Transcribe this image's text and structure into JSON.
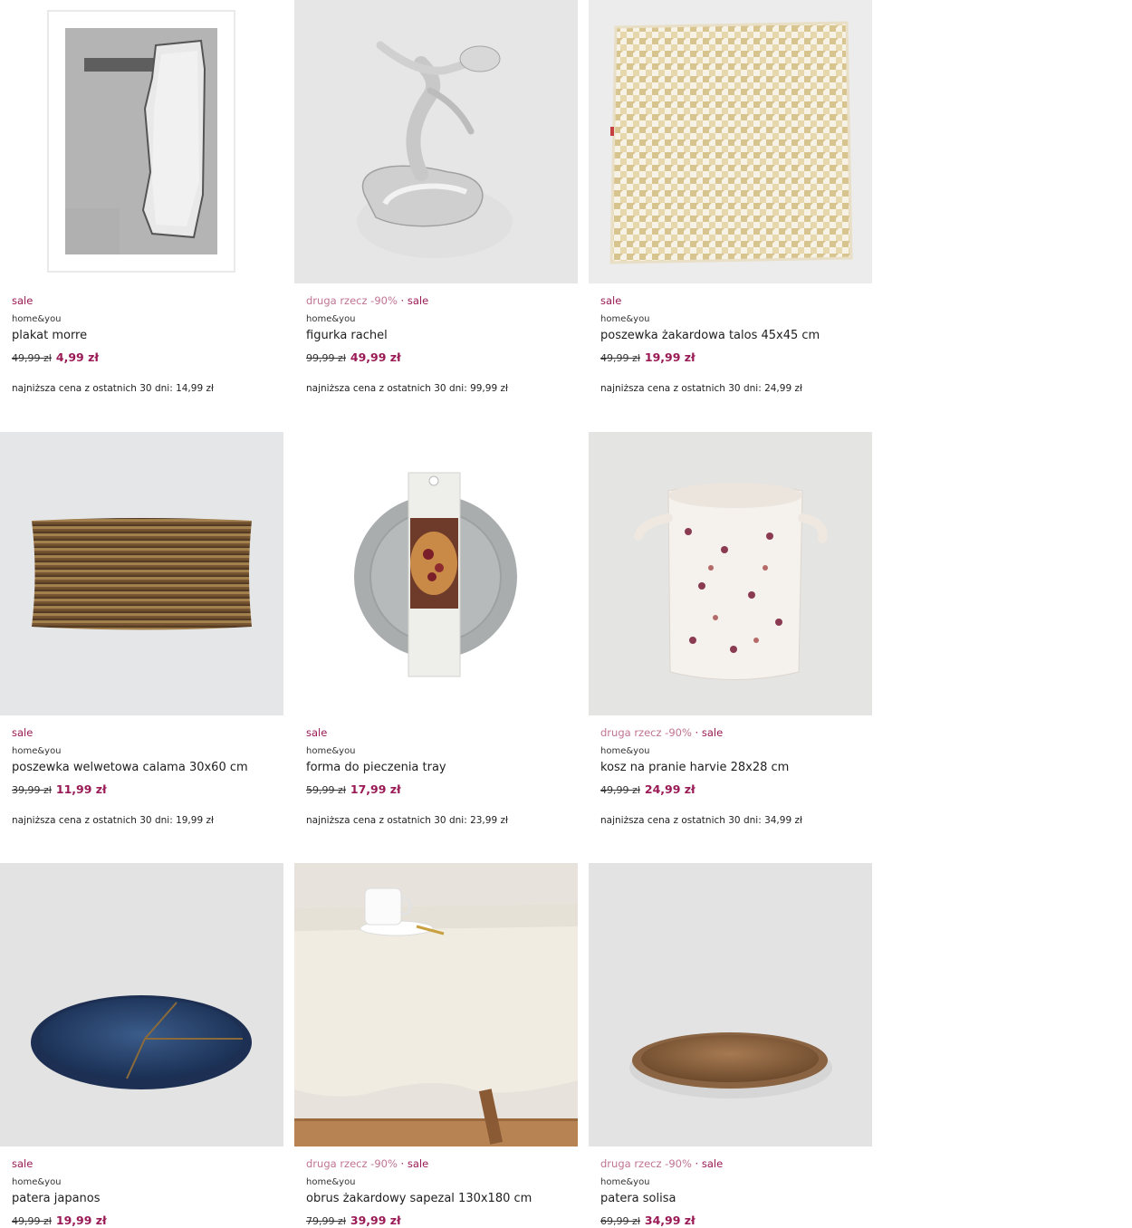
{
  "products": [
    {
      "promo": "",
      "badge": "sale",
      "brand": "home&you",
      "name": "plakat morre",
      "old_price": "49,99 zł",
      "new_price": "4,99 zł",
      "lowest": "najniższa cena z ostatnich 30 dni: 14,99 zł",
      "image": "poster"
    },
    {
      "promo": "druga rzecz -90%",
      "badge": "sale",
      "brand": "home&you",
      "name": "figurka rachel",
      "old_price": "99,99 zł",
      "new_price": "49,99 zł",
      "lowest": "najniższa cena z ostatnich 30 dni: 99,99 zł",
      "image": "figurine"
    },
    {
      "promo": "",
      "badge": "sale",
      "brand": "home&you",
      "name": "poszewka żakardowa talos 45x45 cm",
      "old_price": "49,99 zł",
      "new_price": "19,99 zł",
      "lowest": "najniższa cena z ostatnich 30 dni: 24,99 zł",
      "image": "houndstooth-pillow"
    },
    {
      "promo": "",
      "badge": "sale",
      "brand": "home&you",
      "name": "poszewka welwetowa calama 30x60 cm",
      "old_price": "39,99 zł",
      "new_price": "11,99 zł",
      "lowest": "najniższa cena z ostatnich 30 dni: 19,99 zł",
      "image": "velvet-pillow"
    },
    {
      "promo": "",
      "badge": "sale",
      "brand": "home&you",
      "name": "forma do pieczenia tray",
      "old_price": "59,99 zł",
      "new_price": "17,99 zł",
      "lowest": "najniższa cena z ostatnich 30 dni: 23,99 zł",
      "image": "baking-tray"
    },
    {
      "promo": "druga rzecz -90%",
      "badge": "sale",
      "brand": "home&you",
      "name": "kosz na pranie harvie 28x28 cm",
      "old_price": "49,99 zł",
      "new_price": "24,99 zł",
      "lowest": "najniższa cena z ostatnich 30 dni: 34,99 zł",
      "image": "laundry-basket"
    },
    {
      "promo": "",
      "badge": "sale",
      "brand": "home&you",
      "name": "patera japanos",
      "old_price": "49,99 zł",
      "new_price": "19,99 zł",
      "lowest": "",
      "image": "blue-platter"
    },
    {
      "promo": "druga rzecz -90%",
      "badge": "sale",
      "brand": "home&you",
      "name": "obrus żakardowy sapezal 130x180 cm",
      "old_price": "79,99 zł",
      "new_price": "39,99 zł",
      "lowest": "",
      "image": "tablecloth"
    },
    {
      "promo": "druga rzecz -90%",
      "badge": "sale",
      "brand": "home&you",
      "name": "patera solisa",
      "old_price": "69,99 zł",
      "new_price": "34,99 zł",
      "lowest": "",
      "image": "gold-platter"
    }
  ],
  "separator": "·"
}
